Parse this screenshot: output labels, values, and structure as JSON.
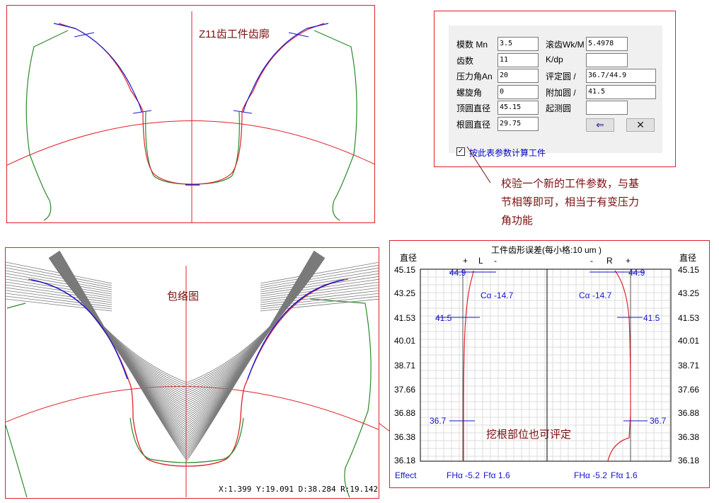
{
  "profile_panel": {
    "title": "Z11齿工件齿廓"
  },
  "envelope_panel": {
    "title": "包络图",
    "coords": "X:1.399  Y:19.091  D:38.284  R:19.142"
  },
  "form": {
    "rows": [
      {
        "label": "模数 Mn",
        "value": "3.5"
      },
      {
        "label": "齿数",
        "value": "11"
      },
      {
        "label": "压力角An",
        "value": "20"
      },
      {
        "label": "螺旋角",
        "value": "0"
      },
      {
        "label": "顶圆直径",
        "value": "45.15"
      },
      {
        "label": "根圆直径",
        "value": "29.75"
      }
    ],
    "right_rows": [
      {
        "label": "滚齿Wk/M",
        "value": "5.4978"
      },
      {
        "label": "K/dp",
        "value": ""
      },
      {
        "label": "评定圆 /",
        "value": "36.7/44.9"
      },
      {
        "label": "附加圆 /",
        "value": "41.5"
      },
      {
        "label": "起测圆",
        "value": ""
      }
    ],
    "apply_button": "⇐",
    "close_button": "✕",
    "checkbox_checked": true,
    "checkbox_mark": "✓",
    "checkbox_label": "按此表参数计算工件"
  },
  "notes": {
    "param_note": [
      "校验一个新的工件参数，与基",
      "节相等即可，相当于有变压力",
      "角功能"
    ],
    "root_note": "挖根部位也可评定"
  },
  "error_chart": {
    "title": "工件齿形误差(每小格:10 um )",
    "diameter_label": "直径",
    "left_flank_header": [
      "+",
      "L",
      "-"
    ],
    "right_flank_header": [
      "-",
      "R",
      "+"
    ],
    "ticks": [
      "45.15",
      "43.25",
      "41.53",
      "40.01",
      "38.71",
      "37.66",
      "36.88",
      "36.38",
      "36.18"
    ],
    "left_markers": [
      "44.9",
      "41.5",
      "36.7"
    ],
    "right_markers": [
      "44.9",
      "41.5",
      "36.7"
    ],
    "calpha_left": "Cα -14.7",
    "calpha_right": "Cα -14.7",
    "effect_label": "Effect",
    "left_fha": "FHα -5.2",
    "left_ffa": "Ffα   1.6",
    "right_fha": "FHα -5.2",
    "right_ffa": "Ffα   1.6"
  },
  "colors": {
    "frame": "#e0202a",
    "involute": "#1a1ad0",
    "gear": "#2a8a2a",
    "curve": "#e0202a",
    "note": "#7a1010"
  }
}
